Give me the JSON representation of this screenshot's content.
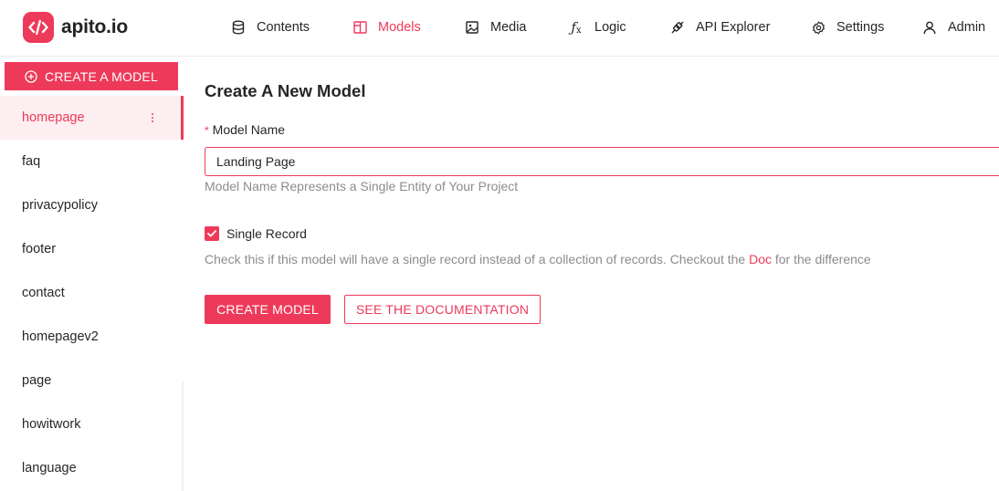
{
  "app": {
    "name": "apito.io",
    "logo_icon": "code-brackets-icon",
    "accent_color": "#ee3a5a"
  },
  "nav": [
    {
      "label": "Contents",
      "icon": "database-icon"
    },
    {
      "label": "Models",
      "icon": "layout-icon",
      "active": true
    },
    {
      "label": "Media",
      "icon": "image-icon"
    },
    {
      "label": "Logic",
      "icon": "function-icon"
    },
    {
      "label": "API Explorer",
      "icon": "api-icon"
    },
    {
      "label": "Settings",
      "icon": "gear-icon"
    },
    {
      "label": "Admin",
      "icon": "user-icon"
    }
  ],
  "sidebar": {
    "create_button": "CREATE A MODEL",
    "create_icon": "plus-circle-icon",
    "models": [
      "homepage",
      "faq",
      "privacypolicy",
      "footer",
      "contact",
      "homepagev2",
      "page",
      "howitwork",
      "language"
    ],
    "active_model": "homepage"
  },
  "form": {
    "title": "Create A New Model",
    "required_mark": "*",
    "model_name_label": "Model Name",
    "model_name_value": "Landing Page",
    "model_name_help": "Model Name Represents a Single Entity of Your Project",
    "single_record_label": "Single Record",
    "single_record_checked": true,
    "single_record_help_before": "Check this if this model will have a single record instead of a collection of records. Checkout the",
    "single_record_help_link": "Doc",
    "single_record_help_after": "for the difference",
    "create_button": "CREATE MODEL",
    "docs_button": "SEE THE DOCUMENTATION"
  }
}
